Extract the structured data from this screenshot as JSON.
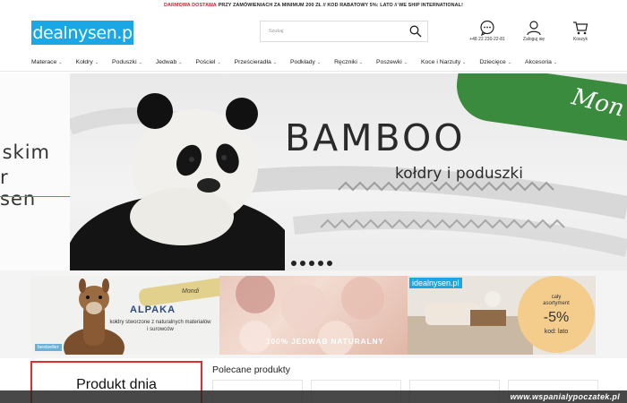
{
  "topbar": {
    "highlight": "DARMOWA DOSTAWA",
    "text": "PRZY ZAMÓWIENIACH ZA MINIMUM 200 ZŁ // KOD RABATOWY 5%: LATO // WE SHIP INTERNATIONAL!"
  },
  "header": {
    "logo": "idealnysen.pl",
    "search_placeholder": "Szukaj",
    "phone": "+48 22 230-22-81",
    "login": "Zaloguj się",
    "cart": "Koszyk"
  },
  "nav": {
    "items": [
      {
        "label": "Materace"
      },
      {
        "label": "Kołdry"
      },
      {
        "label": "Poduszki"
      },
      {
        "label": "Jedwab"
      },
      {
        "label": "Pościel"
      },
      {
        "label": "Prześcieradła"
      },
      {
        "label": "Podkłady"
      },
      {
        "label": "Ręczniki"
      },
      {
        "label": "Poszewki"
      },
      {
        "label": "Koce i Narzuty"
      },
      {
        "label": "Dziecięce"
      },
      {
        "label": "Akcesoria"
      }
    ]
  },
  "hero": {
    "left_line1": "skim",
    "left_line2": "r sen",
    "title": "BAMBOO",
    "subtitle": "kołdry i poduszki",
    "brand": "Mon",
    "slide_count": 5
  },
  "promos": {
    "alpaka_title": "ALPAKA",
    "alpaka_sub": "kołdry stworzone z naturalnych materiałów i surowców",
    "alpaka_brand": "Mondi",
    "alpaka_badge": "bestseller",
    "jedwab_text": "100% JEDWAB NATURALNY",
    "sale_logo": "idealnysen.pl",
    "sale_line1": "cały",
    "sale_line2": "asortyment",
    "sale_value": "-5%",
    "sale_code": "kod: lato"
  },
  "bottom": {
    "product_day": "Produkt dnia",
    "recommended": "Polecane produkty"
  },
  "watermark": "www.wspanialypoczatek.pl",
  "colors": {
    "brand_blue": "#1aa7e6",
    "accent_red": "#d21e2b",
    "green": "#3b8b3e"
  }
}
